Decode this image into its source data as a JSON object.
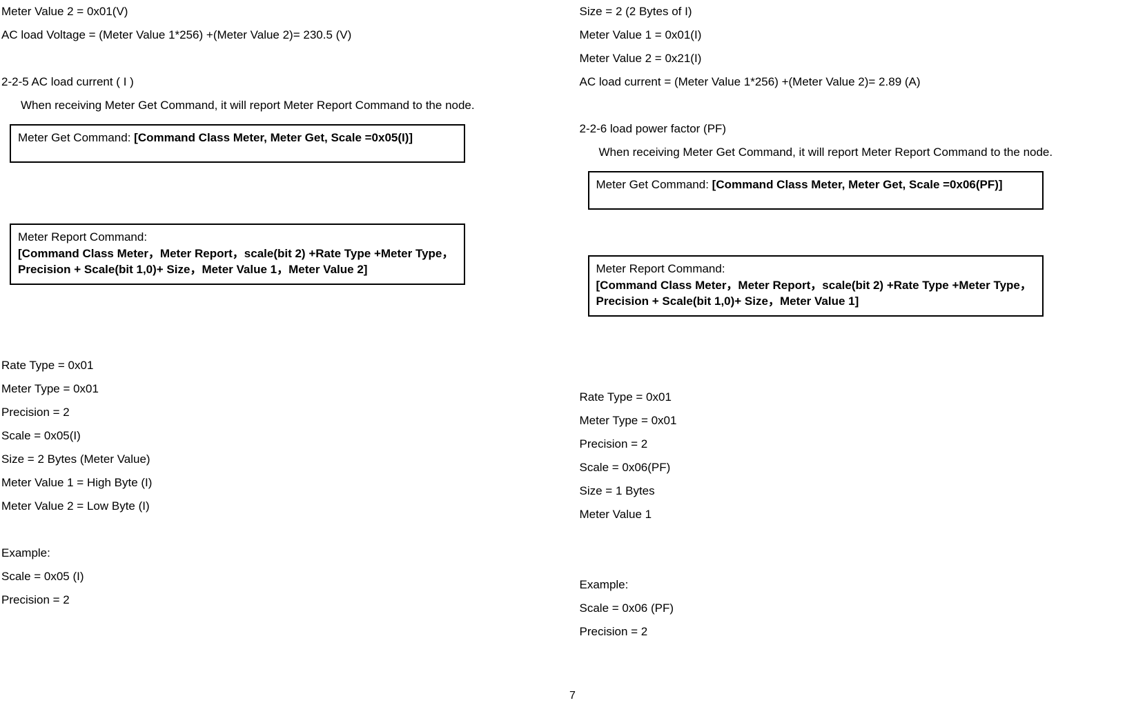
{
  "left": {
    "top1": "Meter Value 2 =  0x01(V)",
    "top2": "AC load Voltage =  (Meter Value 1*256) +(Meter Value 2)= 230.5 (V)",
    "h225": "2-2-5 AC load current ( I )",
    "desc225": "When receiving Meter Get Command, it will report Meter Report Command to the node.",
    "box1_label": "Meter Get Command: ",
    "box1_bold": "[Command Class Meter, Meter Get, Scale =0x05(I)]",
    "box2_label": "Meter Report Command:",
    "box2_bold": "[Command Class Meter，Meter Report，scale(bit 2) +Rate Type +Meter Type，Precision + Scale(bit 1,0)+ Size，Meter Value 1，Meter Value 2]",
    "p1": "Rate Type = 0x01",
    "p2": "Meter Type = 0x01",
    "p3": "Precision = 2",
    "p4": "Scale = 0x05(I)",
    "p5": "Size = 2 Bytes (Meter Value)",
    "p6": "Meter Value 1 = High Byte (I)",
    "p7": "Meter Value 2 = Low Byte (I)",
    "ex": "Example:",
    "ex1": "Scale = 0x05 (I)",
    "ex2": "Precision = 2"
  },
  "right": {
    "top1": "Size = 2 (2 Bytes of I)",
    "top2": "Meter Value 1 =  0x01(I)",
    "top3": "Meter Value 2 =  0x21(I)",
    "top4": "AC load current =  (Meter Value 1*256) +(Meter Value 2)= 2.89 (A)",
    "h226": "2-2-6 load power factor (PF)",
    "desc226": "When receiving Meter Get Command, it will report Meter Report Command to the node.",
    "box1_label": "Meter Get Command: ",
    "box1_bold": "[Command Class Meter, Meter Get, Scale =0x06(PF)]",
    "box2_label": "Meter Report Command:",
    "box2_bold": " [Command Class Meter，Meter Report，scale(bit 2) +Rate Type +Meter Type，Precision + Scale(bit 1,0)+ Size，Meter Value 1]",
    "p1": "Rate Type = 0x01",
    "p2": "Meter Type = 0x01",
    "p3": "Precision = 2",
    "p4": "Scale = 0x06(PF)",
    "p5": "Size = 1 Bytes",
    "p6": "Meter Value 1",
    "ex": "Example:",
    "ex1": "Scale = 0x06 (PF)",
    "ex2": "Precision = 2"
  },
  "page_num": "7"
}
